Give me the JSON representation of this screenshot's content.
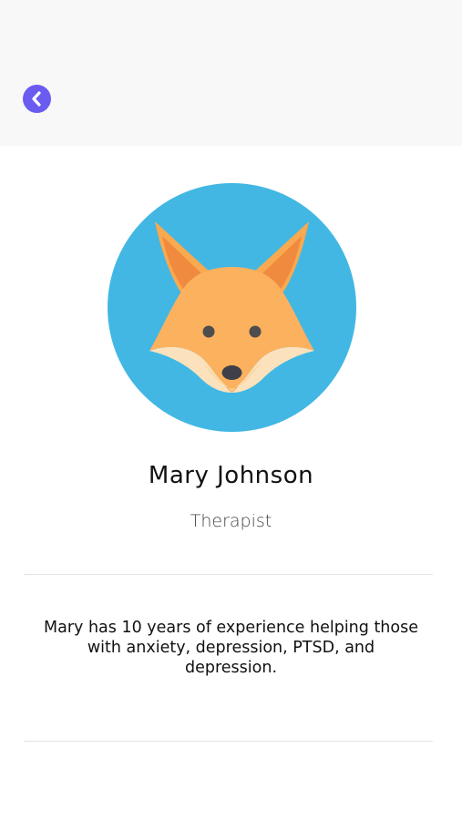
{
  "header": {
    "back_icon": "chevron-left-icon",
    "accent_color": "#6a5cf0"
  },
  "profile": {
    "avatar_icon": "fox-icon",
    "avatar_background": "#42b7e3",
    "name": "Mary Johnson",
    "role": "Therapist",
    "bio": "Mary has 10 years of experience helping those with anxiety, depression, PTSD, and depression."
  }
}
